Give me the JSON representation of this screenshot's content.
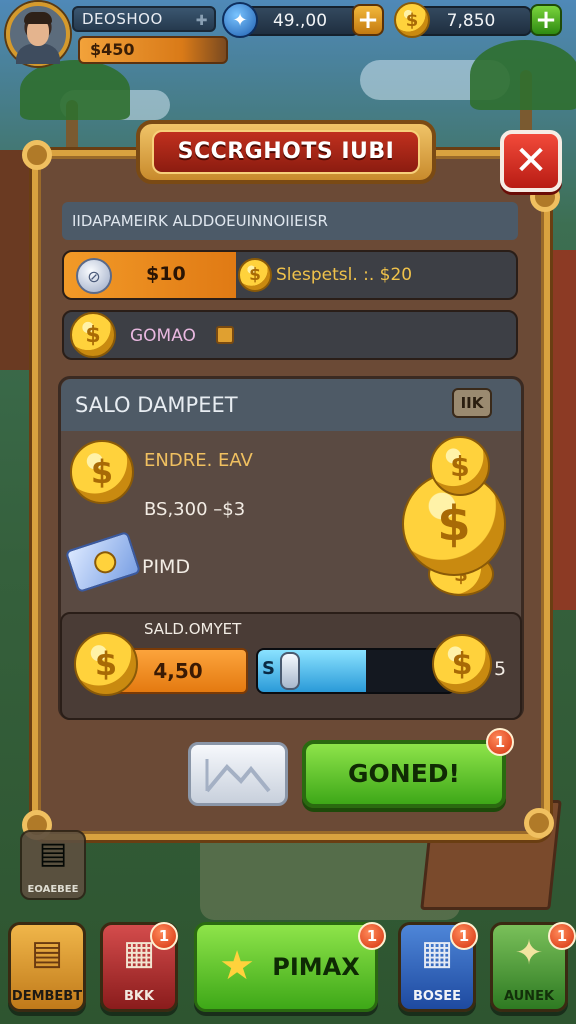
{
  "hud": {
    "player_name": "DEOSHOO",
    "player_coins": "$450",
    "resource_1": "49.,00",
    "resource_2": "7,850"
  },
  "dialog": {
    "title": "SCCRGHOTS IUBI",
    "subtitle": "IIDAPAMEIRK ALDDOEUINNOIIEISR",
    "row1_left": "$10",
    "row1_right": "Slespetsl. :. $20",
    "row2_label": "GOMAO",
    "panel_title": "SALO DAMPEET",
    "panel_tag": "IIK",
    "info_line_1": "ENDRE. EAV",
    "info_line_2": "BS,300 –$3",
    "info_line_3": "PIMD",
    "slider_label": "SALD.OMYET",
    "amount_value": "4,50",
    "slider_start": "S",
    "slider_end": "5",
    "slider_level": 0.3,
    "confirm_button": "GONED!",
    "confirm_badge": "1"
  },
  "side_card_label": "EOAEBEE",
  "bottom_nav": [
    {
      "label": "DEMBEBT",
      "badge": ""
    },
    {
      "label": "BKK",
      "badge": "1"
    },
    {
      "label": "PIMAX",
      "badge": "1"
    },
    {
      "label": "BOSEE",
      "badge": "1"
    },
    {
      "label": "AUNEK",
      "badge": "1"
    }
  ],
  "icons": {
    "avatar": "player-portrait",
    "resource_1_icon": "blue-gem-icon",
    "resource_2_icon": "gold-coin-icon",
    "close": "close-icon",
    "coins": "gold-coin-icon",
    "cash": "cash-bundle-icon"
  },
  "colors": {
    "accent_orange": "#e47a10",
    "confirm_green": "#3ea818",
    "close_red": "#d42a1c",
    "frame_gold": "#d9a23f"
  }
}
